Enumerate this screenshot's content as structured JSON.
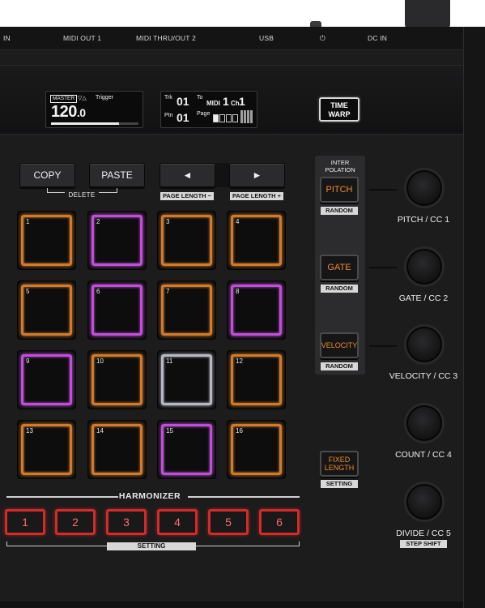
{
  "back_panel": {
    "ports": [
      "IN",
      "MIDI OUT 1",
      "MIDI THRU/OUT 2",
      "USB",
      "⏻",
      "DC IN"
    ]
  },
  "display_left": {
    "master_tag": "MASTER",
    "sync_icon": "▽△",
    "trigger_label": "Trigger",
    "bpm_int": "120",
    "bpm_dec": ".0",
    "progress": 0.78
  },
  "display_right": {
    "trk_label": "Trk",
    "trk_value": "01",
    "to_label": "To",
    "midi_label": "MIDI",
    "midi_value": "1",
    "ch_label": "Ch",
    "ch_value": "1",
    "ptn_label": "Ptn",
    "ptn_value": "01",
    "page_label": "Page",
    "pages_filled": 1,
    "pages_total": 4
  },
  "time_warp": {
    "line1": "TIME",
    "line2": "WARP"
  },
  "edit_buttons": {
    "copy": "COPY",
    "paste": "PASTE",
    "delete": "DELETE"
  },
  "page_buttons": {
    "left_icon": "◄",
    "right_icon": "►",
    "length_minus": "PAGE LENGTH −",
    "length_plus": "PAGE LENGTH +"
  },
  "pads": [
    {
      "num": "1",
      "color": "#d07a2a"
    },
    {
      "num": "2",
      "color": "#c04fd8"
    },
    {
      "num": "3",
      "color": "#d07a2a"
    },
    {
      "num": "4",
      "color": "#d07a2a"
    },
    {
      "num": "5",
      "color": "#d07a2a"
    },
    {
      "num": "6",
      "color": "#c04fd8"
    },
    {
      "num": "7",
      "color": "#d07a2a"
    },
    {
      "num": "8",
      "color": "#c04fd8"
    },
    {
      "num": "9",
      "color": "#c04fd8"
    },
    {
      "num": "10",
      "color": "#d07a2a"
    },
    {
      "num": "11",
      "color": "#b8b8c4"
    },
    {
      "num": "12",
      "color": "#d07a2a"
    },
    {
      "num": "13",
      "color": "#d07a2a"
    },
    {
      "num": "14",
      "color": "#d07a2a"
    },
    {
      "num": "15",
      "color": "#c04fd8"
    },
    {
      "num": "16",
      "color": "#d07a2a"
    }
  ],
  "interpolation": {
    "title_line1": "INTER",
    "title_line2": "POLATION",
    "pitch": "PITCH",
    "gate": "GATE",
    "velocity": "VELOCITY",
    "random": "RANDOM"
  },
  "fixed_length": {
    "line1": "FIXED",
    "line2": "LENGTH",
    "setting": "SETTING"
  },
  "knobs": [
    "PITCH / CC 1",
    "GATE / CC 2",
    "VELOCITY / CC 3",
    "COUNT / CC 4",
    "DIVIDE / CC 5"
  ],
  "step_shift": "STEP SHIFT",
  "harmonizer": {
    "title": "HARMONIZER",
    "buttons": [
      "1",
      "2",
      "3",
      "4",
      "5",
      "6"
    ],
    "setting": "SETTING"
  },
  "colors": {
    "orange": "#d07a2a",
    "purple": "#c04fd8",
    "white": "#b8b8c4",
    "red": "#d42a2a"
  }
}
